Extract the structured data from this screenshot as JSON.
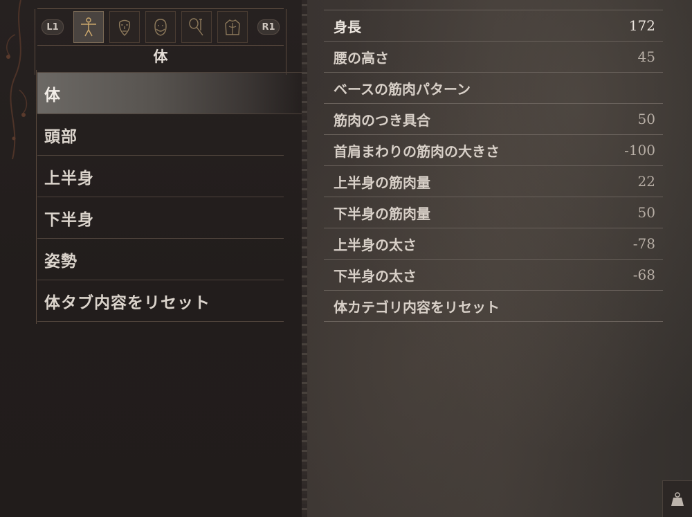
{
  "tabs": {
    "prev_label": "L1",
    "next_label": "R1",
    "items": [
      {
        "icon": "body-figure-icon",
        "active": true
      },
      {
        "icon": "face-icon",
        "active": false
      },
      {
        "icon": "head-hair-icon",
        "active": false
      },
      {
        "icon": "makeup-tools-icon",
        "active": false
      },
      {
        "icon": "torso-icon",
        "active": false
      }
    ]
  },
  "category_title": "体",
  "categories": [
    {
      "label": "体",
      "selected": true
    },
    {
      "label": "頭部",
      "selected": false
    },
    {
      "label": "上半身",
      "selected": false
    },
    {
      "label": "下半身",
      "selected": false
    },
    {
      "label": "姿勢",
      "selected": false
    },
    {
      "label": "体タブ内容をリセット",
      "selected": false
    }
  ],
  "parameters": [
    {
      "name": "身長",
      "value": "172"
    },
    {
      "name": "腰の高さ",
      "value": "45"
    },
    {
      "name": "ベースの筋肉パターン",
      "value": ""
    },
    {
      "name": "筋肉のつき具合",
      "value": "50"
    },
    {
      "name": "首肩まわりの筋肉の大きさ",
      "value": "-100"
    },
    {
      "name": "上半身の筋肉量",
      "value": "22"
    },
    {
      "name": "下半身の筋肉量",
      "value": "50"
    },
    {
      "name": "上半身の太さ",
      "value": "-78"
    },
    {
      "name": "下半身の太さ",
      "value": "-68"
    },
    {
      "name": "体カテゴリ内容をリセット",
      "value": ""
    }
  ],
  "colors": {
    "background": "#231e1d",
    "accent_line": "#5b4a3e",
    "text": "#ddd6cf"
  }
}
